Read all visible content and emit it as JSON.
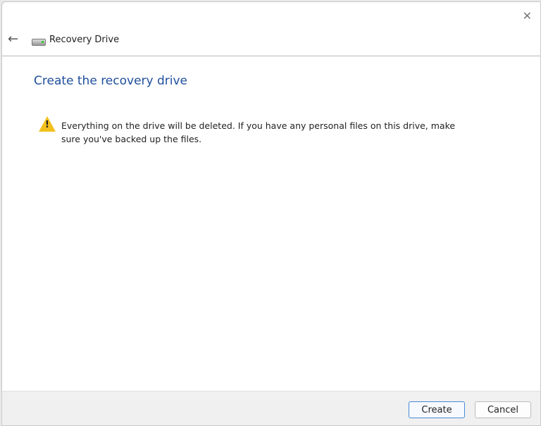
{
  "window": {
    "title": "Recovery Drive",
    "close": "✕",
    "back": "←"
  },
  "heading": "Create the recovery drive",
  "warning": "Everything on the drive will be deleted. If you have any personal files on this drive, make sure you've backed up the files.",
  "buttons": {
    "create": "Create",
    "cancel": "Cancel"
  }
}
